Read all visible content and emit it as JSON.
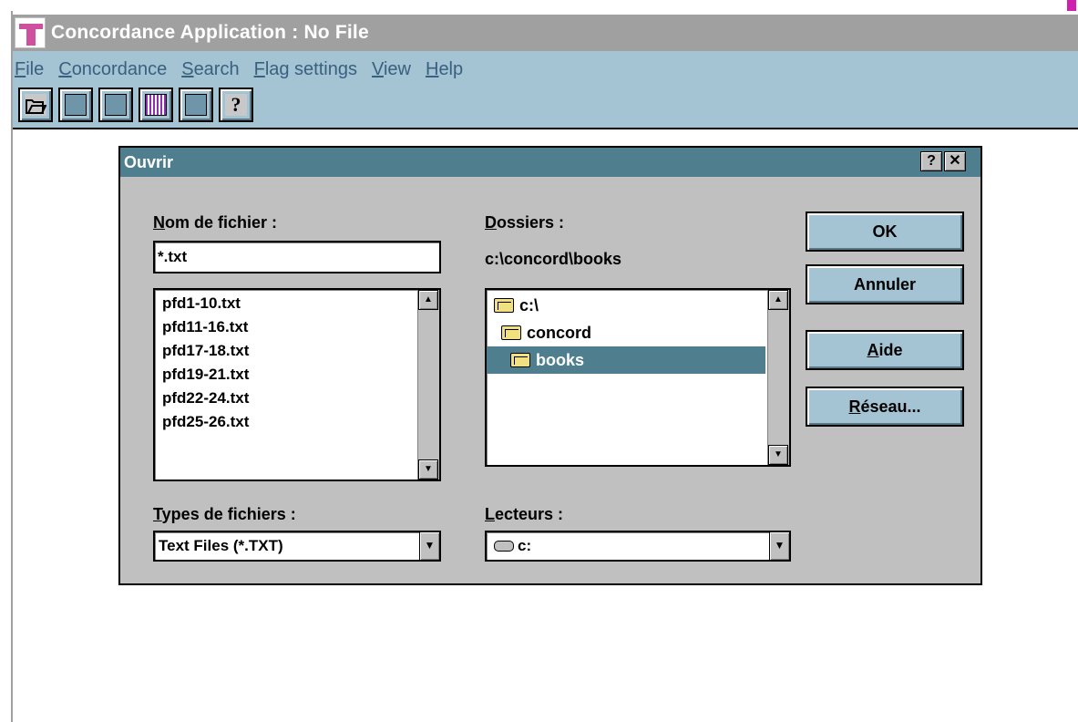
{
  "app": {
    "title": "Concordance Application : No File",
    "icon": "concordance-app-icon"
  },
  "menu": {
    "items": [
      {
        "label_ul": "F",
        "label_rest": "ile"
      },
      {
        "label_ul": "C",
        "label_rest": "oncordance"
      },
      {
        "label_ul": "S",
        "label_rest": "earch"
      },
      {
        "label_ul": "F",
        "label_rest": "lag settings"
      },
      {
        "label_ul": "V",
        "label_rest": "iew"
      },
      {
        "label_ul": "H",
        "label_rest": "elp"
      }
    ]
  },
  "toolbar": {
    "buttons": [
      "open-file-icon",
      "blank-icon",
      "blank-icon",
      "list-icon",
      "blank-icon",
      "help-icon"
    ],
    "help_glyph": "?"
  },
  "dialog": {
    "title": "Ouvrir",
    "help_cap": "?",
    "close_cap": "✕",
    "filename": {
      "label_ul": "N",
      "label_rest": "om de fichier :",
      "value": "*.txt"
    },
    "files": [
      "pfd1-10.txt",
      "pfd11-16.txt",
      "pfd17-18.txt",
      "pfd19-21.txt",
      "pfd22-24.txt",
      "pfd25-26.txt"
    ],
    "folders": {
      "label_ul": "D",
      "label_rest": "ossiers :",
      "current_path": "c:\\concord\\books",
      "items": [
        {
          "name": "c:\\",
          "selected": false
        },
        {
          "name": "concord",
          "selected": false
        },
        {
          "name": "books",
          "selected": true
        }
      ]
    },
    "file_types": {
      "label_ul": "T",
      "label_rest": "ypes de fichiers :",
      "value": "Text Files (*.TXT)"
    },
    "drives": {
      "label_ul": "L",
      "label_rest": "ecteurs :",
      "value": "c:"
    },
    "buttons": {
      "ok": "OK",
      "cancel": "Annuler",
      "help_ul": "A",
      "help_rest": "ide",
      "network_ul": "R",
      "network_rest": "éseau..."
    }
  }
}
